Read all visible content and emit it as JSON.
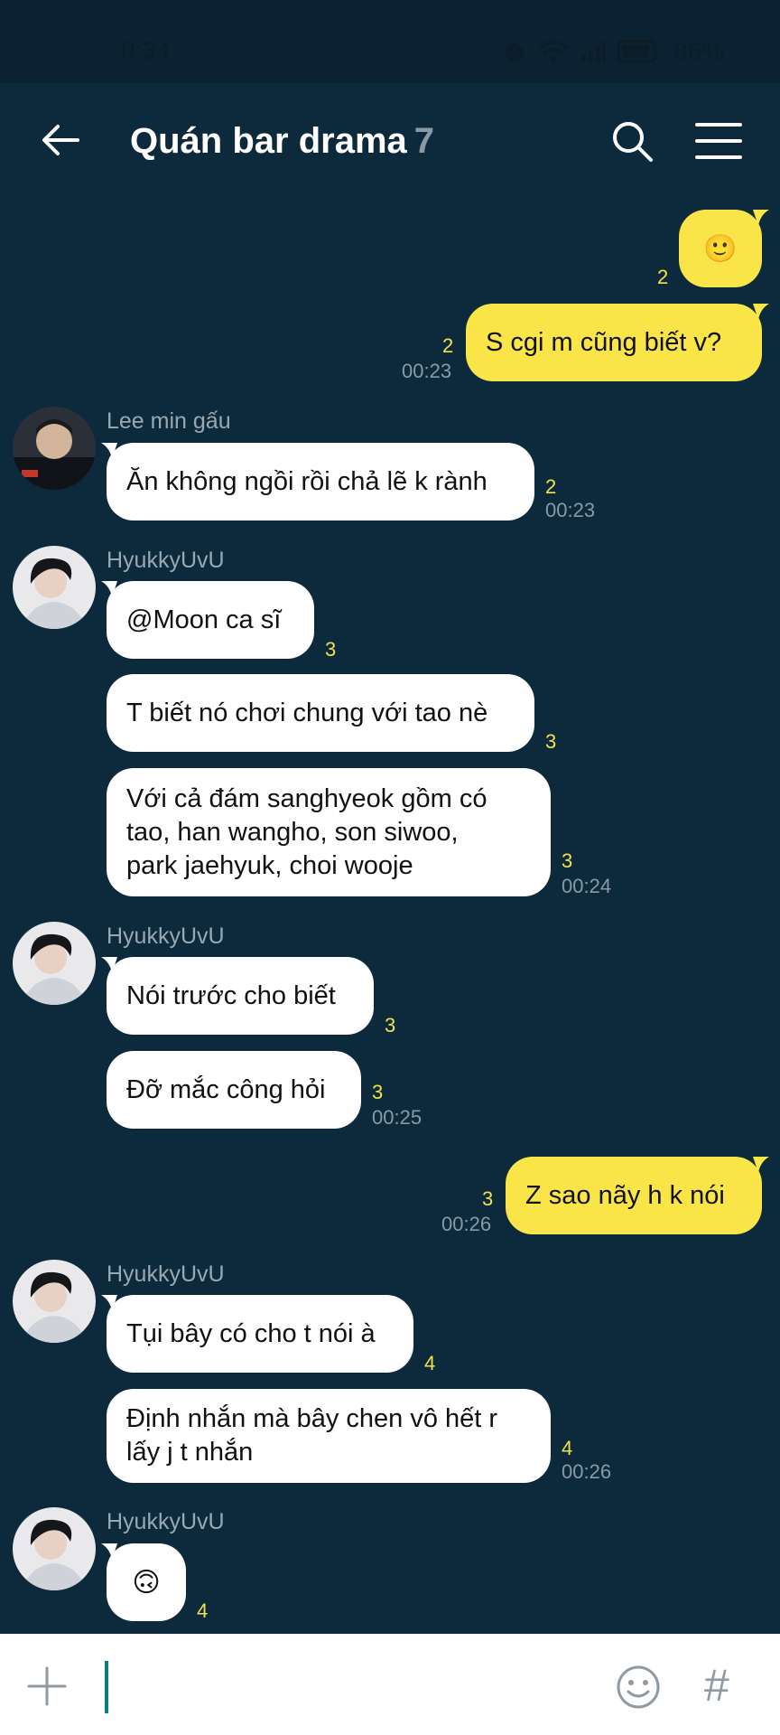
{
  "status": {
    "time": "0:34",
    "battery": "86%"
  },
  "header": {
    "title": "Quán bar drama",
    "member_count": "7"
  },
  "messages": {
    "m1": {
      "text": "🙂",
      "unread": "2"
    },
    "m2": {
      "text": "S cgi m cũng biết v?",
      "unread": "2",
      "time": "00:23"
    },
    "g1": {
      "sender": "Lee min gấu",
      "m3": "Ăn không ngồi rồi chả lẽ k rành",
      "m3_unread": "2",
      "m3_time": "00:23"
    },
    "g2": {
      "sender": "HyukkyUvU",
      "m4": "@Moon ca sĩ",
      "m4_unread": "3",
      "m5": "T biết nó chơi chung với tao nè",
      "m5_unread": "3",
      "m6_line1": "Với cả đám sanghyeok gồm có",
      "m6_line2": "tao, han wangho, son siwoo,",
      "m6_line3": "park jaehyuk, choi wooje",
      "m6_unread": "3",
      "m6_time": "00:24"
    },
    "g3": {
      "sender": "HyukkyUvU",
      "m7": "Nói trước cho biết",
      "m7_unread": "3",
      "m8": "Đỡ mắc công hỏi",
      "m8_unread": "3",
      "m8_time": "00:25"
    },
    "m9": {
      "text": "Z sao nãy h k nói",
      "unread": "3",
      "time": "00:26"
    },
    "g4": {
      "sender": "HyukkyUvU",
      "m10": "Tụi bây có cho t nói à",
      "m10_unread": "4",
      "m11_line1": "Định nhắn mà bây chen vô hết r",
      "m11_line2": "lấy j t nhắn",
      "m11_unread": "4",
      "m11_time": "00:26"
    },
    "g5": {
      "sender": "HyukkyUvU",
      "m12": "🙃",
      "m12_unread": "4"
    }
  },
  "colors": {
    "background": "#0c2a3c",
    "outgoing": "#f9e547",
    "incoming": "#ffffff",
    "unread": "#f2e24b"
  }
}
